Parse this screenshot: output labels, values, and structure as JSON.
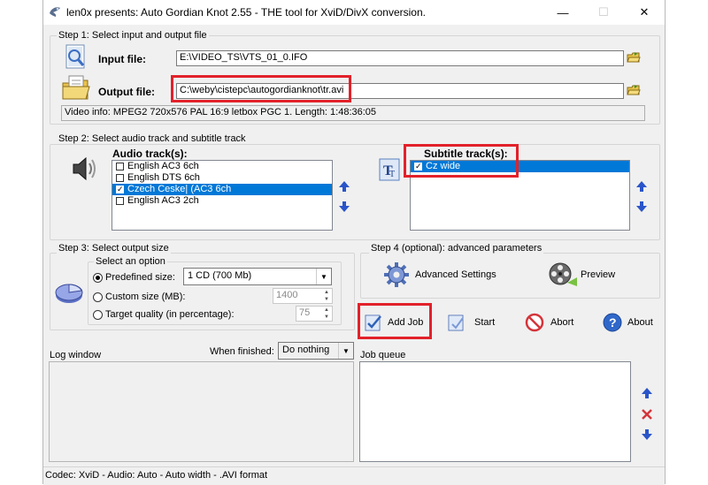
{
  "window": {
    "title": "len0x presents: Auto Gordian Knot 2.55 - THE tool for XviD/DivX conversion.",
    "controls": {
      "minimize": "—",
      "maximize": "☐",
      "close": "✕"
    }
  },
  "step1": {
    "label": "Step 1: Select input and output file",
    "input_label": "Input file:",
    "input_value": "E:\\VIDEO_TS\\VTS_01_0.IFO",
    "output_label": "Output file:",
    "output_value": "C:\\weby\\cistepc\\autogordianknot\\tr.avi",
    "video_info": "Video info: MPEG2 720x576 PAL 16:9 letbox  PGC 1. Length: 1:48:36:05"
  },
  "step2": {
    "label": "Step 2: Select audio track and subtitle track",
    "audio_label": "Audio track(s):",
    "audio_tracks": [
      {
        "label": "English AC3 6ch",
        "checked": false,
        "selected": false
      },
      {
        "label": "English DTS 6ch",
        "checked": false,
        "selected": false
      },
      {
        "label": "Czech Ceske| (AC3 6ch",
        "checked": true,
        "selected": true
      },
      {
        "label": "English AC3 2ch",
        "checked": false,
        "selected": false
      }
    ],
    "subtitle_label": "Subtitle track(s):",
    "subtitle_tracks": [
      {
        "label": "Cz wide",
        "checked": true,
        "selected": true
      }
    ]
  },
  "step3": {
    "label": "Step 3: Select output size",
    "option_label": "Select an option",
    "predefined_label": "Predefined size:",
    "predefined_value": "1 CD (700 Mb)",
    "custom_label": "Custom size (MB):",
    "custom_value": "1400",
    "quality_label": "Target quality (in percentage):",
    "quality_value": "75"
  },
  "step4": {
    "label": "Step 4 (optional): advanced parameters",
    "advanced_label": "Advanced Settings",
    "preview_label": "Preview"
  },
  "actions": {
    "add_job": "Add Job",
    "start": "Start",
    "abort": "Abort",
    "about": "About"
  },
  "log": {
    "label": "Log window",
    "when_finished_label": "When finished:",
    "when_finished_value": "Do nothing"
  },
  "queue": {
    "label": "Job queue"
  },
  "status": "Codec: XviD -  Audio: Auto -  Auto width - .AVI format",
  "colors": {
    "highlight": "#0078d7",
    "annotation": "#e2212a",
    "arrow": "#2a55c9"
  }
}
